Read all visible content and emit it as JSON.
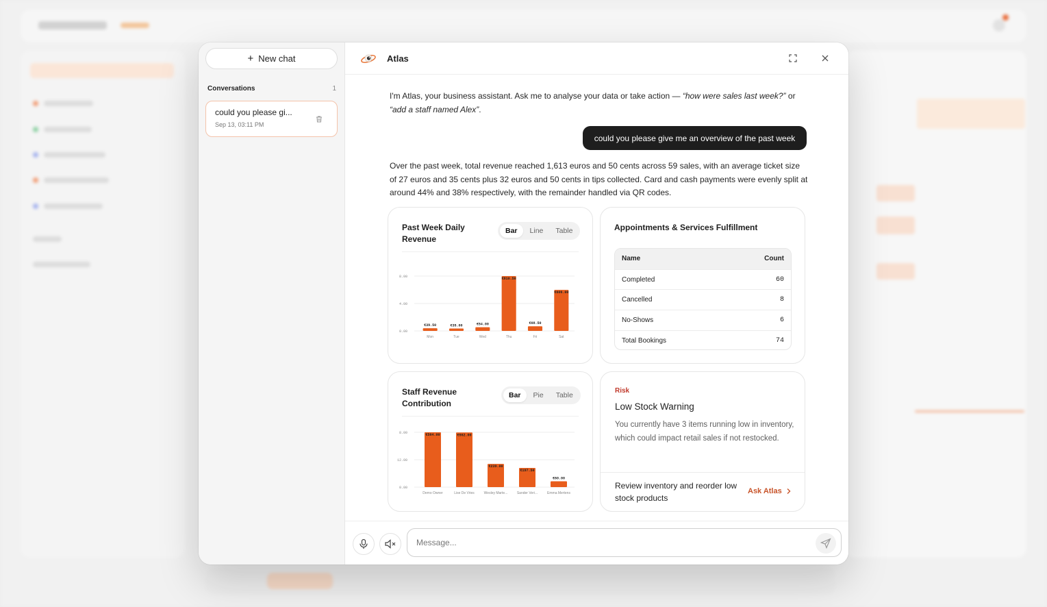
{
  "sidebar": {
    "new_chat_label": "New chat",
    "conversations_label": "Conversations",
    "conversations_count": "1",
    "conversations": [
      {
        "title": "could you please gi...",
        "date": "Sep 13, 03:11 PM"
      }
    ]
  },
  "header": {
    "title": "Atlas"
  },
  "chat": {
    "intro_plain": "I'm Atlas, your business assistant. Ask me to analyse your data or take action — ",
    "intro_example_1": "“how were sales last week?”",
    "intro_or": " or ",
    "intro_example_2": "“add a staff named Alex”",
    "intro_end": ".",
    "user_message": "could you please give me an overview of the past week",
    "answer": "Over the past week, total revenue reached 1,613 euros and 50 cents across 59 sales, with an average ticket size of 27 euros and 35 cents plus 32 euros and 50 cents in tips collected. Card and cash payments were evenly split at around 44% and 38% respectively, with the remainder handled via QR codes."
  },
  "cards": {
    "daily_revenue": {
      "title": "Past Week Daily Revenue",
      "tabs": [
        "Bar",
        "Line",
        "Table"
      ],
      "active_tab": "Bar"
    },
    "appointments": {
      "title": "Appointments & Services Fulfillment",
      "headers": [
        "Name",
        "Count"
      ],
      "rows": [
        [
          "Completed",
          "60"
        ],
        [
          "Cancelled",
          "8"
        ],
        [
          "No-Shows",
          "6"
        ],
        [
          "Total Bookings",
          "74"
        ]
      ]
    },
    "staff_revenue": {
      "title": "Staff Revenue Contribution",
      "tabs": [
        "Bar",
        "Pie",
        "Table"
      ],
      "active_tab": "Bar"
    },
    "risk": {
      "label": "Risk",
      "title": "Low Stock Warning",
      "text": "You currently have 3 items running low in inventory, which could impact retail sales if not restocked.",
      "action": "Review inventory and reorder low stock products",
      "cta": "Ask Atlas"
    }
  },
  "composer": {
    "placeholder": "Message..."
  },
  "colors": {
    "accent": "#e85d1c",
    "user_bubble": "#1e1e1e",
    "risk": "#c0392b",
    "cta": "#c8542a"
  },
  "chart_data": [
    {
      "type": "bar",
      "title": "Past Week Daily Revenue",
      "categories": [
        "Mon",
        "Tue",
        "Wed",
        "Thu",
        "Fri",
        "Sat"
      ],
      "values": [
        39.5,
        35.0,
        54.0,
        810.5,
        68.5,
        606.0
      ],
      "value_labels": [
        "€39.50",
        "€35.00",
        "€54.00",
        "€810.50",
        "€68.50",
        "€606.00"
      ],
      "y_ticks": [
        "0.00",
        "4.00",
        "8.00"
      ],
      "ylim": [
        0,
        810.5
      ],
      "grid": true
    },
    {
      "type": "bar",
      "title": "Staff Revenue Contribution",
      "categories": [
        "Demo Owner",
        "Lise De Vries",
        "Wesley Marte...",
        "Sander Veri...",
        "Emma Mertens"
      ],
      "values": [
        564.0,
        562.0,
        239.0,
        197.5,
        60.0
      ],
      "value_labels": [
        "€564.00",
        "€562.00",
        "€239.00",
        "€197.50",
        "€60.00"
      ],
      "y_ticks": [
        "0.00",
        "12.00",
        "8.00"
      ],
      "ylim": [
        0,
        564.0
      ],
      "grid": true
    }
  ]
}
